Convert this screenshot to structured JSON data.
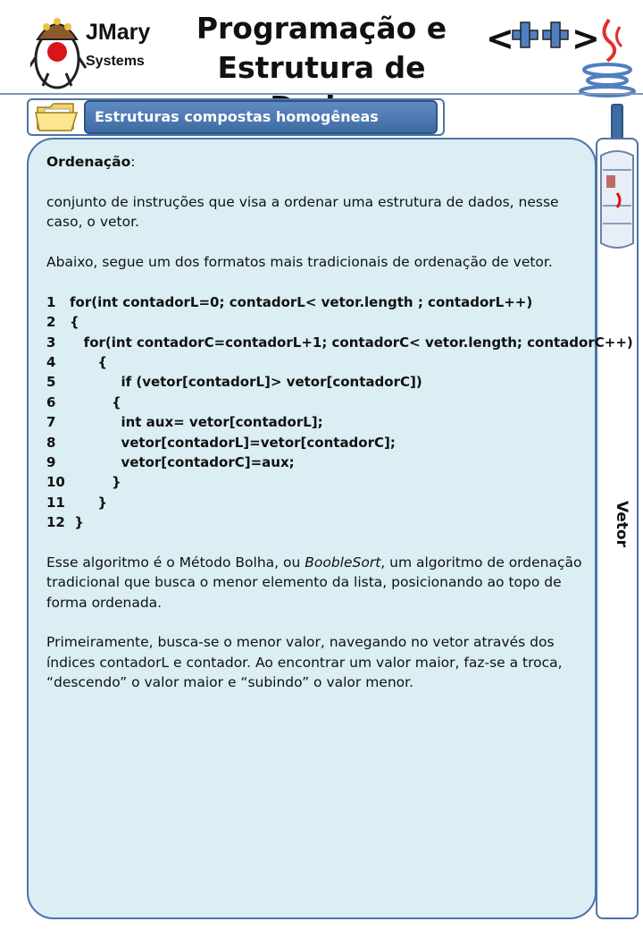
{
  "header": {
    "logo_line1": "JMary",
    "logo_line2": "Systems",
    "title_line1": "Programação e",
    "title_line2": "Estrutura de Dados",
    "cpp_text": "<++>"
  },
  "section": {
    "label": "Estruturas compostas homogêneas"
  },
  "side_tab": {
    "label": "Vetor"
  },
  "content": {
    "heading": "Ordenação",
    "heading_suffix": ":",
    "definition": "conjunto de instruções que visa a ordenar uma estrutura de dados, nesse caso, o vetor.",
    "intro": "Abaixo, segue um dos formatos mais tradicionais de ordenação de vetor.",
    "code": [
      {
        "n": "1",
        "text": "for(int contadorL=0; contadorL< vetor.length ; contadorL++)"
      },
      {
        "n": "2",
        "text": "{"
      },
      {
        "n": "3",
        "text": "   for(int contadorC=contadorL+1; contadorC< vetor.length; contadorC++)"
      },
      {
        "n": "4",
        "text": "      {"
      },
      {
        "n": "5",
        "text": "           if (vetor[contadorL]> vetor[contadorC])"
      },
      {
        "n": "6",
        "text": "         {"
      },
      {
        "n": "7",
        "text": "           int aux= vetor[contadorL];"
      },
      {
        "n": "8",
        "text": "           vetor[contadorL]=vetor[contadorC];"
      },
      {
        "n": "9",
        "text": "           vetor[contadorC]=aux;"
      },
      {
        "n": "10",
        "text": "         }"
      },
      {
        "n": "11",
        "text": "      }"
      },
      {
        "n": "12",
        "text": " }"
      }
    ],
    "explain_before": "Esse algoritmo é o Método Bolha, ou ",
    "explain_italic": "BoobleSort",
    "explain_after": ", um algoritmo de ordenação tradicional que busca o menor elemento da lista, posicionando ao topo de forma ordenada.",
    "final": "Primeiramente, busca-se o menor valor, navegando no vetor através dos índices contadorL e contador. Ao encontrar um valor maior, faz-se a troca, “descendo” o valor maior e “subindo” o valor menor."
  },
  "colors": {
    "panel_bg": "#daeef3",
    "border": "#4a74a6",
    "accent": "#3f6ba3"
  }
}
